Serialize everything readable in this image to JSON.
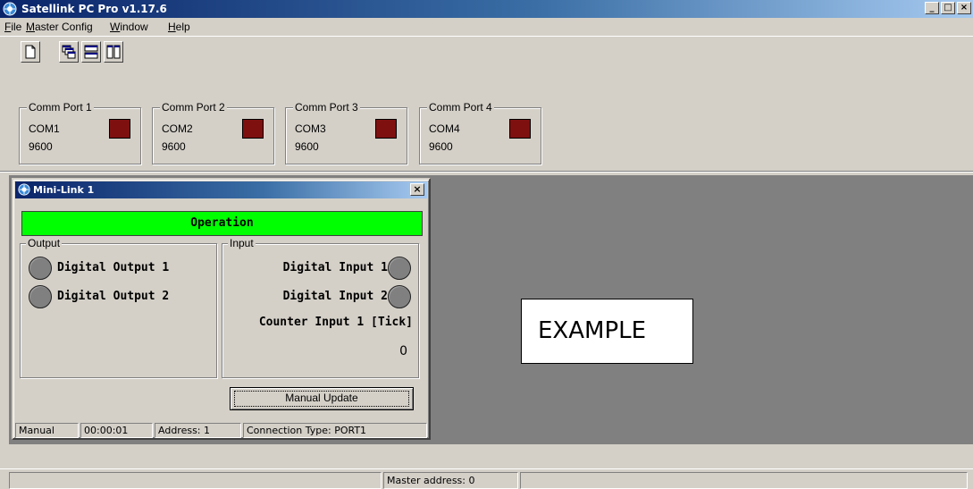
{
  "window": {
    "title": "Satellink PC Pro v1.17.6",
    "min_glyph": "_",
    "max_glyph": "□",
    "close_glyph": "×",
    "icon": "satellite-app-icon"
  },
  "menu": [
    {
      "label": "File",
      "accel": "F"
    },
    {
      "label": "Master Config",
      "accel": "M"
    },
    {
      "label": "Window",
      "accel": "W"
    },
    {
      "label": "Help",
      "accel": "H"
    }
  ],
  "toolbar": {
    "icons": [
      "new-document-icon",
      "cascade-windows-icon",
      "tile-horizontal-icon",
      "tile-vertical-icon"
    ]
  },
  "comm_ports": [
    {
      "title": "Comm Port 1",
      "port": "COM1",
      "baud": "9600",
      "led_color": "#7f1010"
    },
    {
      "title": "Comm Port 2",
      "port": "COM2",
      "baud": "9600",
      "led_color": "#7f1010"
    },
    {
      "title": "Comm Port 3",
      "port": "COM3",
      "baud": "9600",
      "led_color": "#7f1010"
    },
    {
      "title": "Comm Port 4",
      "port": "COM4",
      "baud": "9600",
      "led_color": "#7f1010"
    }
  ],
  "child_window": {
    "title": "Mini-Link 1",
    "close_glyph": "×",
    "mode_text": "Operation",
    "mode_color": "#00ff00",
    "output_group": "Output",
    "outputs": [
      "Digital Output 1",
      "Digital Output 2"
    ],
    "input_group": "Input",
    "inputs": [
      "Digital Input 1",
      "Digital Input 2"
    ],
    "counter_label": "Counter Input 1 [Tick]",
    "counter_value": "0",
    "manual_update_label": "Manual Update",
    "status": {
      "mode": "Manual",
      "time": "00:00:01",
      "address": "Address: 1",
      "connection": "Connection Type: PORT1"
    }
  },
  "overlay_label": "EXAMPLE",
  "main_status": {
    "master_address": "Master address: 0"
  }
}
